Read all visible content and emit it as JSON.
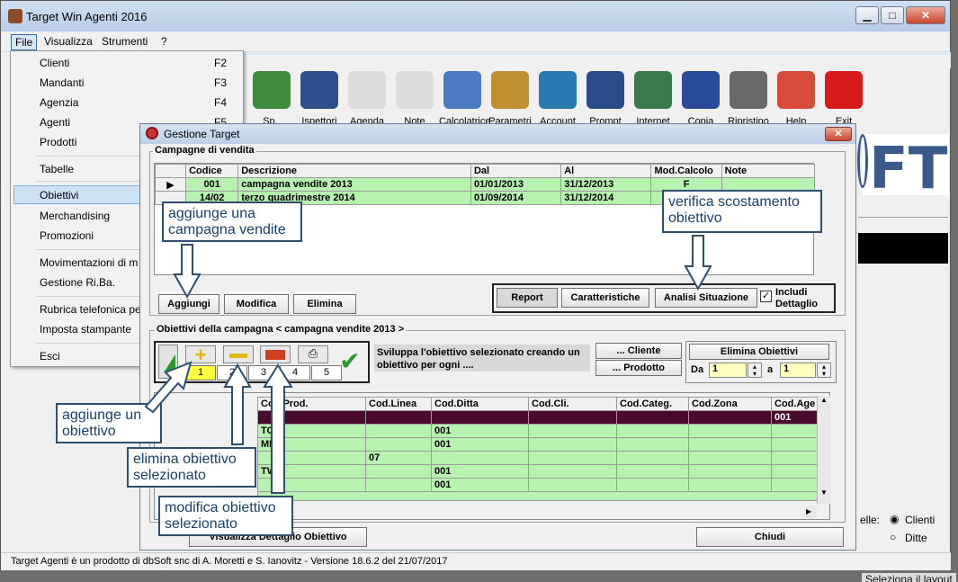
{
  "window": {
    "title": "Target Win Agenti 2016",
    "min": "▁",
    "max": "□",
    "close": "✕"
  },
  "menubar": {
    "file": "File",
    "view": "Visualizza",
    "tools": "Strumenti",
    "help": "?"
  },
  "toolbar": [
    {
      "label": "Sp..",
      "icon": "money-icon"
    },
    {
      "label": "Ispettori",
      "icon": "inspector-icon"
    },
    {
      "label": "Agenda",
      "icon": "calendar-icon"
    },
    {
      "label": "Note",
      "icon": "notes-icon"
    },
    {
      "label": "Calcolatrice",
      "icon": "calculator-icon"
    },
    {
      "label": "Parametri",
      "icon": "gear-icon"
    },
    {
      "label": "Account",
      "icon": "users-icon"
    },
    {
      "label": "Prompt",
      "icon": "cmd-icon"
    },
    {
      "label": "Internet",
      "icon": "internet-icon"
    },
    {
      "label": "Copia",
      "icon": "disk-icon"
    },
    {
      "label": "Ripristino",
      "icon": "tools-icon"
    },
    {
      "label": "Help",
      "icon": "lifebuoy-icon"
    },
    {
      "label": "Exit",
      "icon": "exit-icon"
    }
  ],
  "filemenu": [
    {
      "label": "Clienti",
      "key": "F2"
    },
    {
      "label": "Mandanti",
      "key": "F3"
    },
    {
      "label": "Agenzia",
      "key": "F4"
    },
    {
      "label": "Agenti",
      "key": "F5"
    },
    {
      "label": "Prodotti",
      "key": ""
    },
    {
      "label": "Tabelle",
      "key": ""
    },
    {
      "label": "Obiettivi",
      "key": ""
    },
    {
      "label": "Merchandising",
      "key": ""
    },
    {
      "label": "Promozioni",
      "key": ""
    },
    {
      "label": "Movimentazioni di m",
      "key": ""
    },
    {
      "label": "Gestione Ri.Ba.",
      "key": ""
    },
    {
      "label": "Rubrica telefonica pe",
      "key": ""
    },
    {
      "label": "Imposta stampante",
      "key": ""
    },
    {
      "label": "Esci",
      "key": ""
    }
  ],
  "logo": "FT",
  "right": {
    "label": "elle:",
    "opt1": "Clienti",
    "opt2": "Ditte",
    "below": "Seleziona il layout"
  },
  "status": "Target Agenti è un prodotto di dbSoft snc di A. Moretti e S. Ianovitz   -   Versione 18.6.2 del 21/07/2017",
  "dialog": {
    "title": "Gestione Target",
    "close": "✕",
    "campaigns": {
      "label": "Campagne di vendita",
      "columns": [
        "Codice",
        "Descrizione",
        "Dal",
        "Al",
        "Mod.Calcolo",
        "Note"
      ],
      "rows": [
        [
          "001",
          "campagna vendite 2013",
          "01/01/2013",
          "31/12/2013",
          "F",
          ""
        ],
        [
          "14/02",
          "terzo quadrimestre 2014",
          "01/09/2014",
          "31/12/2014",
          "",
          ""
        ]
      ],
      "add": "Aggiungi",
      "edit": "Modifica",
      "delete": "Elimina",
      "report": "Report",
      "features": "Caratteristiche",
      "analysis": "Analisi Situazione",
      "include": "Includi Dettaglio"
    },
    "objectives": {
      "label": "Obiettivi della campagna < campagna vendite 2013 >",
      "nums": [
        "1",
        "2",
        "3",
        "4",
        "5"
      ],
      "develop": "Sviluppa l'obiettivo selezionato creando un obiettivo per ogni ....",
      "cliente": "... Cliente",
      "prodotto": "... Prodotto",
      "elimina": "Elimina Obiettivi",
      "da": "Da",
      "da_val": "1",
      "a": "a",
      "a_val": "1",
      "columns": [
        "Cod.Prod.",
        "Cod.Linea",
        "Cod.Ditta",
        "Cod.Cli.",
        "Cod.Categ.",
        "Cod.Zona",
        "Cod.Age"
      ],
      "rows": [
        [
          "",
          "",
          "",
          "",
          "",
          "",
          "001"
        ],
        [
          "TO",
          "",
          "001",
          "",
          "",
          "",
          ""
        ],
        [
          "MR",
          "",
          "001",
          "",
          "",
          "",
          ""
        ],
        [
          "",
          "07",
          "",
          "",
          "",
          "",
          ""
        ],
        [
          "TW",
          "",
          "001",
          "",
          "",
          "",
          ""
        ],
        [
          "",
          "",
          "001",
          "",
          "",
          "",
          ""
        ]
      ],
      "detail": "Visualizza Dettaglio Obiettivo",
      "close": "Chiudi"
    }
  },
  "callouts": {
    "add_campaign": "aggiunge una campagna vendite",
    "verify": "verifica scostamento obiettivo",
    "add_obj": "aggiunge un obiettivo",
    "del_obj": "elimina obiettivo selezionato",
    "mod_obj": "modifica obiettivo selezionato"
  }
}
